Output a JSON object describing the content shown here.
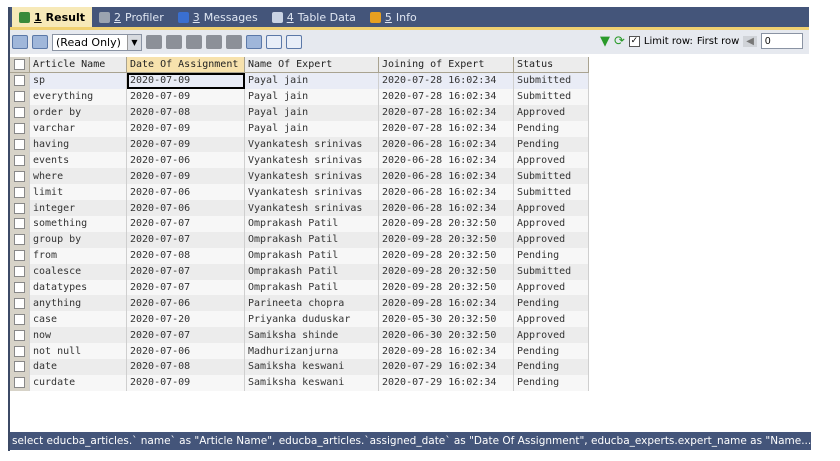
{
  "tabs": [
    {
      "num": "1",
      "label": "Result",
      "icon": "grid-result-icon",
      "color": "#3a8a3a"
    },
    {
      "num": "2",
      "label": "Profiler",
      "icon": "profiler-icon",
      "color": "#9aa3b0"
    },
    {
      "num": "3",
      "label": "Messages",
      "icon": "info-icon",
      "color": "#3a6fd0"
    },
    {
      "num": "4",
      "label": "Table Data",
      "icon": "table-icon",
      "color": "#c9d3e4"
    },
    {
      "num": "5",
      "label": "Info",
      "icon": "info-box-icon",
      "color": "#e8a020"
    }
  ],
  "toolbar": {
    "mode": "(Read Only)",
    "limit_label": "Limit row:",
    "first_row_label": "First row",
    "first_row_value": "0",
    "limit_checked": true
  },
  "columns": [
    "Article Name",
    "Date Of Assignment",
    "Name Of Expert",
    "Joining of Expert",
    "Status"
  ],
  "rows": [
    [
      "sp",
      "2020-07-09",
      "Payal jain",
      "2020-07-28 16:02:34",
      "Submitted"
    ],
    [
      "everything",
      "2020-07-09",
      "Payal jain",
      "2020-07-28 16:02:34",
      "Submitted"
    ],
    [
      "order by",
      "2020-07-08",
      "Payal jain",
      "2020-07-28 16:02:34",
      "Approved"
    ],
    [
      "varchar",
      "2020-07-09",
      "Payal jain",
      "2020-07-28 16:02:34",
      "Pending"
    ],
    [
      "having",
      "2020-07-09",
      "Vyankatesh srinivas",
      "2020-06-28 16:02:34",
      "Pending"
    ],
    [
      "events",
      "2020-07-06",
      "Vyankatesh srinivas",
      "2020-06-28 16:02:34",
      "Approved"
    ],
    [
      "where",
      "2020-07-09",
      "Vyankatesh srinivas",
      "2020-06-28 16:02:34",
      "Submitted"
    ],
    [
      "limit",
      "2020-07-06",
      "Vyankatesh srinivas",
      "2020-06-28 16:02:34",
      "Submitted"
    ],
    [
      "integer",
      "2020-07-06",
      "Vyankatesh srinivas",
      "2020-06-28 16:02:34",
      "Approved"
    ],
    [
      "something",
      "2020-07-07",
      "Omprakash Patil",
      "2020-09-28 20:32:50",
      "Approved"
    ],
    [
      "group by",
      "2020-07-07",
      "Omprakash Patil",
      "2020-09-28 20:32:50",
      "Approved"
    ],
    [
      "from",
      "2020-07-08",
      "Omprakash Patil",
      "2020-09-28 20:32:50",
      "Pending"
    ],
    [
      "coalesce",
      "2020-07-07",
      "Omprakash Patil",
      "2020-09-28 20:32:50",
      "Submitted"
    ],
    [
      "datatypes",
      "2020-07-07",
      "Omprakash Patil",
      "2020-09-28 20:32:50",
      "Approved"
    ],
    [
      "anything",
      "2020-07-06",
      "Parineeta chopra",
      "2020-09-28 16:02:34",
      "Pending"
    ],
    [
      "case",
      "2020-07-20",
      "Priyanka duduskar",
      "2020-05-30 20:32:50",
      "Approved"
    ],
    [
      "now",
      "2020-07-07",
      "Samiksha shinde",
      "2020-06-30 20:32:50",
      "Approved"
    ],
    [
      "not null",
      "2020-07-06",
      "Madhurizanjurna",
      "2020-09-28 16:02:34",
      "Pending"
    ],
    [
      "date",
      "2020-07-08",
      "Samiksha keswani",
      "2020-07-29 16:02:34",
      "Pending"
    ],
    [
      "curdate",
      "2020-07-09",
      "Samiksha keswani",
      "2020-07-29 16:02:34",
      "Pending"
    ]
  ],
  "status_sql": "select educba_articles.` name` as \"Article Name\", educba_articles.`assigned_date` as \"Date Of Assignment\", educba_experts.expert_name as \"Name..."
}
